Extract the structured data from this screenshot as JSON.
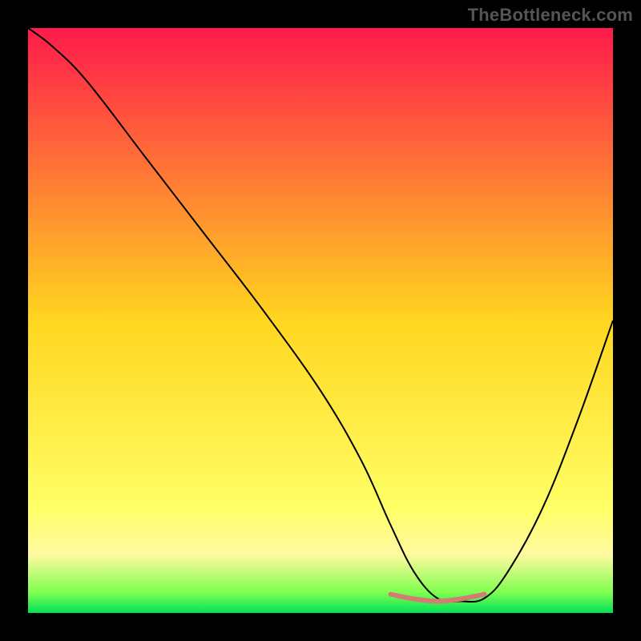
{
  "watermark": "TheBottleneck.com",
  "chart_data": {
    "type": "line",
    "title": "",
    "xlabel": "",
    "ylabel": "",
    "xlim": [
      0,
      100
    ],
    "ylim": [
      0,
      100
    ],
    "grid": false,
    "legend": false,
    "background_gradient": {
      "stops": [
        {
          "offset": 0.0,
          "color": "#ff1a4b"
        },
        {
          "offset": 0.5,
          "color": "#ffd61f"
        },
        {
          "offset": 0.82,
          "color": "#ffff66"
        },
        {
          "offset": 0.9,
          "color": "#fff9a0"
        },
        {
          "offset": 0.965,
          "color": "#7fff4f"
        },
        {
          "offset": 1.0,
          "color": "#00e05a"
        }
      ]
    },
    "series": [
      {
        "name": "bottleneck-curve",
        "color": "#000000",
        "width": 2,
        "x": [
          0,
          4,
          10,
          20,
          30,
          40,
          50,
          57,
          62,
          66,
          70,
          74,
          78,
          82,
          88,
          94,
          100
        ],
        "y": [
          100,
          97,
          91,
          78,
          65,
          52,
          38,
          26,
          15,
          7,
          2.5,
          2,
          2.5,
          7,
          18,
          33,
          50
        ]
      },
      {
        "name": "optimal-range-marker",
        "color": "#d57b74",
        "width": 6,
        "linecap": "round",
        "x": [
          62,
          66,
          70,
          74,
          78
        ],
        "y": [
          3.2,
          2.4,
          2.0,
          2.4,
          3.2
        ]
      }
    ]
  }
}
